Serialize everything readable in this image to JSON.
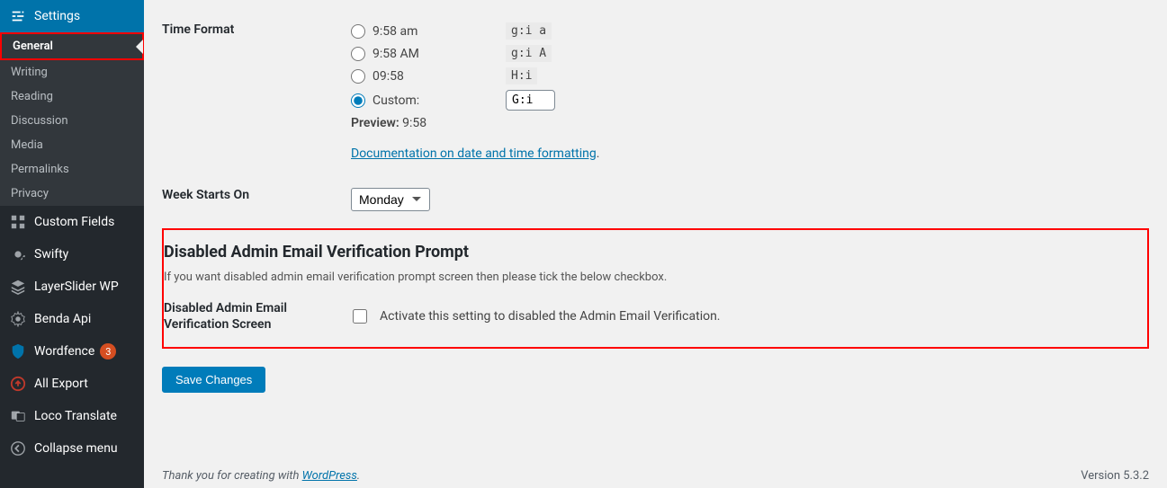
{
  "sidebar": {
    "settings_label": "Settings",
    "sub": {
      "general": "General",
      "writing": "Writing",
      "reading": "Reading",
      "discussion": "Discussion",
      "media": "Media",
      "permalinks": "Permalinks",
      "privacy": "Privacy"
    },
    "custom_fields": "Custom Fields",
    "swifty": "Swifty",
    "layerslider": "LayerSlider WP",
    "benda_api": "Benda Api",
    "wordfence": "Wordfence",
    "wordfence_badge": "3",
    "all_export": "All Export",
    "loco": "Loco Translate",
    "collapse": "Collapse menu"
  },
  "time_format": {
    "heading": "Time Format",
    "options": [
      {
        "label": "9:58 am",
        "code": "g:i a",
        "selected": false
      },
      {
        "label": "9:58 AM",
        "code": "g:i A",
        "selected": false
      },
      {
        "label": "09:58",
        "code": "H:i",
        "selected": false
      }
    ],
    "custom_label": "Custom:",
    "custom_value": "G:i",
    "preview_label": "Preview:",
    "preview_value": "9:58",
    "doc_text": "Documentation on date and time formatting",
    "doc_suffix": "."
  },
  "week": {
    "heading": "Week Starts On",
    "value": "Monday"
  },
  "disabled_section": {
    "heading": "Disabled Admin Email Verification Prompt",
    "desc": "If you want disabled admin email verification prompt screen then please tick the below checkbox.",
    "field_label": "Disabled Admin Email Verification Screen",
    "checkbox_desc": "Activate this setting to disabled the Admin Email Verification."
  },
  "save_label": "Save Changes",
  "footer": {
    "thank_prefix": "Thank you for creating with ",
    "wp": "WordPress",
    "thank_suffix": ".",
    "version": "Version 5.3.2"
  }
}
